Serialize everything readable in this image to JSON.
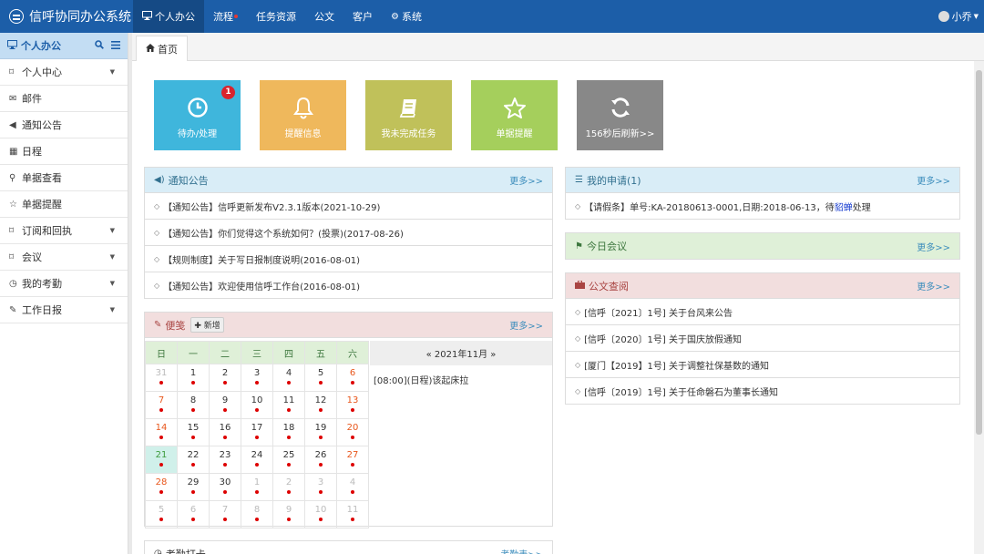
{
  "app": {
    "title": "信呼协同办公系统"
  },
  "nav": {
    "items": [
      {
        "label": "个人办公",
        "icon": "monitor-icon"
      },
      {
        "label": "流程",
        "has_dot": true
      },
      {
        "label": "任务资源"
      },
      {
        "label": "公文"
      },
      {
        "label": "客户"
      },
      {
        "label": "系统",
        "icon": "gear-icon"
      }
    ],
    "active_index": 0,
    "user": "小乔"
  },
  "sidebar": {
    "title": "个人办公",
    "items": [
      {
        "label": "个人中心",
        "icon": "bookmark-icon",
        "expandable": true
      },
      {
        "label": "邮件",
        "icon": "envelope-icon"
      },
      {
        "label": "通知公告",
        "icon": "volume-icon"
      },
      {
        "label": "日程",
        "icon": "calendar-icon"
      },
      {
        "label": "单据查看",
        "icon": "search-icon"
      },
      {
        "label": "单据提醒",
        "icon": "star-icon"
      },
      {
        "label": "订阅和回执",
        "icon": "bookmark-icon",
        "expandable": true
      },
      {
        "label": "会议",
        "icon": "bookmark-icon",
        "expandable": true
      },
      {
        "label": "我的考勤",
        "icon": "clock-icon",
        "expandable": true
      },
      {
        "label": "工作日报",
        "icon": "edit-icon",
        "expandable": true
      }
    ]
  },
  "tabs": [
    {
      "label": "首页",
      "icon": "home-icon"
    }
  ],
  "tiles": [
    {
      "label": "待办/处理",
      "icon": "clock-icon",
      "badge": "1",
      "color": "#3fb6dc"
    },
    {
      "label": "提醒信息",
      "icon": "bell-icon",
      "color": "#efb85c"
    },
    {
      "label": "我未完成任务",
      "icon": "book-icon",
      "color": "#c0c15a"
    },
    {
      "label": "单据提醒",
      "icon": "star-icon",
      "color": "#a5cf5c"
    },
    {
      "label": "156秒后刷新>>",
      "icon": "refresh-icon",
      "color": "#888888"
    }
  ],
  "notices": {
    "title": "通知公告",
    "more": "更多>>",
    "items": [
      "【通知公告】信呼更新发布V2.3.1版本(2021-10-29)",
      "【通知公告】你们觉得这个系统如何？(投票)(2017-08-26)",
      "【规则制度】关于写日报制度说明(2016-08-01)",
      "【通知公告】欢迎使用信呼工作台(2016-08-01)"
    ]
  },
  "memo": {
    "title": "便笺",
    "add_label": "新增",
    "more": "更多>>",
    "weekdays": [
      "日",
      "一",
      "二",
      "三",
      "四",
      "五",
      "六"
    ],
    "month_label": "« 2021年11月 »",
    "event": "[08:00](日程)该起床拉",
    "weeks": [
      [
        "31",
        "1",
        "2",
        "3",
        "4",
        "5",
        "6"
      ],
      [
        "7",
        "8",
        "9",
        "10",
        "11",
        "12",
        "13"
      ],
      [
        "14",
        "15",
        "16",
        "17",
        "18",
        "19",
        "20"
      ],
      [
        "21",
        "22",
        "23",
        "24",
        "25",
        "26",
        "27"
      ],
      [
        "28",
        "29",
        "30",
        "1",
        "2",
        "3",
        "4"
      ],
      [
        "5",
        "6",
        "7",
        "8",
        "9",
        "10",
        "11"
      ]
    ]
  },
  "attendance": {
    "title": "考勤打卡",
    "more": "考勤表>>"
  },
  "applications": {
    "title": "我的申请(1)",
    "more": "更多>>",
    "item": {
      "pre": "【请假条】单号:KA-20180613-0001,日期:2018-06-13，待",
      "link": "貂蝉",
      "post": "处理"
    }
  },
  "meetings": {
    "title": "今日会议",
    "more": "更多>>"
  },
  "documents": {
    "title": "公文查阅",
    "more": "更多>>",
    "items": [
      "[信呼〔2021〕1号] 关于台风来公告",
      "[信呼〔2020〕1号] 关于国庆放假通知",
      "[厦门【2019】1号] 关于调整社保基数的通知",
      "[信呼〔2019〕1号] 关于任命磐石为董事长通知"
    ]
  }
}
